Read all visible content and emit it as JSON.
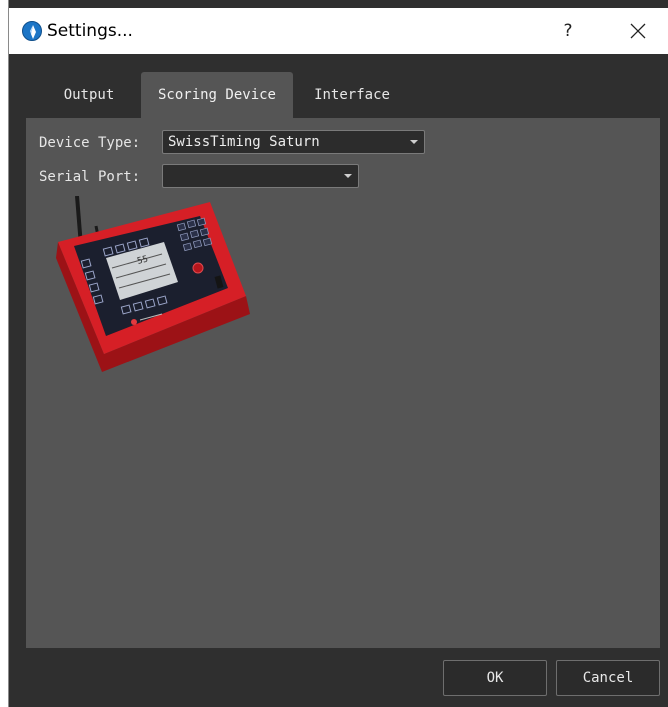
{
  "window": {
    "title": "Settings...",
    "help_label": "?",
    "close_icon": "close-icon"
  },
  "tabs": [
    {
      "label": "Output",
      "selected": false
    },
    {
      "label": "Scoring Device",
      "selected": true
    },
    {
      "label": "Interface",
      "selected": false
    }
  ],
  "form": {
    "device_type_label": "Device Type:",
    "device_type_value": "SwissTiming Saturn",
    "serial_port_label": "Serial Port:",
    "serial_port_value": ""
  },
  "device_image": {
    "icon": "scoring-device-image",
    "display_text": "55"
  },
  "buttons": {
    "ok": "OK",
    "cancel": "Cancel"
  },
  "colors": {
    "dialog_bg": "#2f2f2f",
    "panel_bg": "#555555",
    "device_red": "#d61f26"
  }
}
